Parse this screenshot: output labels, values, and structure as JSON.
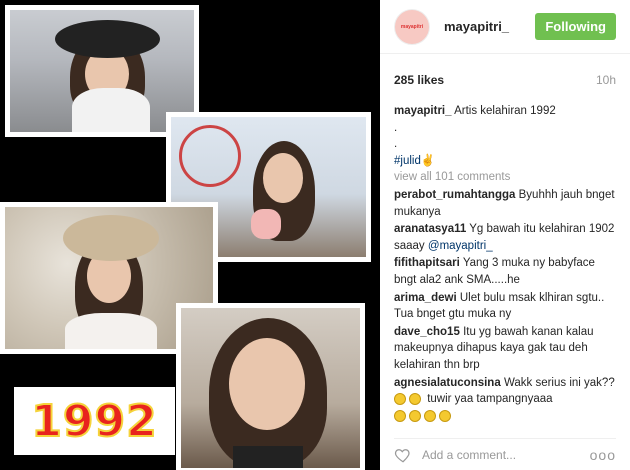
{
  "collage": {
    "badge_text": "1992"
  },
  "post": {
    "username": "mayapitri_",
    "avatar_text": "mayapitri",
    "follow_label": "Following",
    "likes": "285 likes",
    "time": "10h",
    "caption_user": "mayapitri_",
    "caption_text": "Artis kelahiran 1992",
    "caption_line2": ".",
    "caption_line3": ".",
    "caption_tag": "#julid",
    "view_all": "view all 101 comments",
    "add_comment_placeholder": "Add a comment...",
    "more": "ooo"
  },
  "comments": [
    {
      "user": "perabot_rumahtangga",
      "text": "Byuhhh jauh bnget mukanya"
    },
    {
      "user": "aranatasya11",
      "text": "Yg bawah itu kelahiran 1902 saaay",
      "mention": "@mayapitri_"
    },
    {
      "user": "fifithapitsari",
      "text": "Yang 3 muka ny babyface bngt ala2 ank SMA.....he"
    },
    {
      "user": "arima_dewi",
      "text": "Ulet bulu msak klhiran sgtu.. Tua bnget gtu muka ny"
    },
    {
      "user": "dave_cho15",
      "text": "Itu yg bawah kanan kalau makeupnya dihapus kaya gak tau deh kelahiran thn brp"
    },
    {
      "user": "agnesialatuconsina",
      "text": "Wakk serius ini yak??",
      "text2": "tuwir yaa tampangnyaaa"
    }
  ]
}
